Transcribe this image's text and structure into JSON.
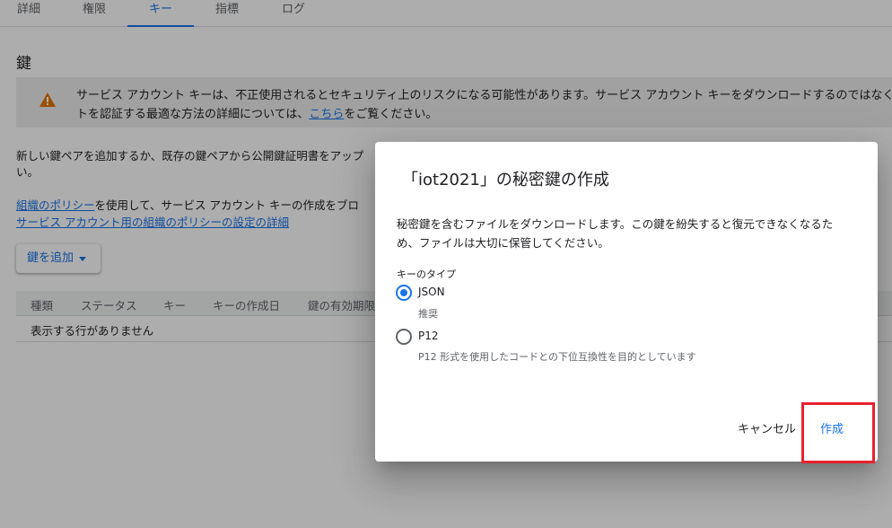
{
  "tabs": [
    {
      "label": "詳細"
    },
    {
      "label": "権限"
    },
    {
      "label": "キー",
      "active": true
    },
    {
      "label": "指標"
    },
    {
      "label": "ログ"
    }
  ],
  "section_title": "鍵",
  "warning": {
    "icon": "warning-icon",
    "line1": "サービス アカウント キーは、不正使用されるとセキュリティ上のリスクになる可能性があります。サービス アカウント キーをダウンロードするのではなく",
    "line2_prefix": "トを認証する最適な方法の詳細については、",
    "line2_link": "こちら",
    "line2_suffix": "をご覧ください。"
  },
  "intro": {
    "line1": "新しい鍵ペアを追加するか、既存の鍵ペアから公開鍵証明書をアップ",
    "line2": "い。"
  },
  "policy": {
    "link1": "組織のポリシー",
    "line1_rest": "を使用して、サービス アカウント キーの作成をブロ",
    "link2": "サービス アカウント用の組織のポリシーの設定の詳細"
  },
  "add_key_button": "鍵を追加",
  "table": {
    "headers": [
      "種類",
      "ステータス",
      "キー",
      "キーの作成日",
      "鍵の有効期限"
    ],
    "empty_text": "表示する行がありません"
  },
  "dialog": {
    "title": "「iot2021」の秘密鍵の作成",
    "description_line1": "秘密鍵を含むファイルをダウンロードします。この鍵を紛失すると復元できなくなるた",
    "description_line2": "め、ファイルは大切に保管してください。",
    "key_type_label": "キーのタイプ",
    "options": [
      {
        "label": "JSON",
        "sub": "推奨",
        "selected": true
      },
      {
        "label": "P12",
        "sub": "P12 形式を使用したコードとの下位互換性を目的としています",
        "selected": false
      }
    ],
    "cancel_label": "キャンセル",
    "create_label": "作成"
  },
  "colors": {
    "accent": "#1a73e8",
    "warning": "#e37400",
    "highlight": "#e8212d"
  }
}
